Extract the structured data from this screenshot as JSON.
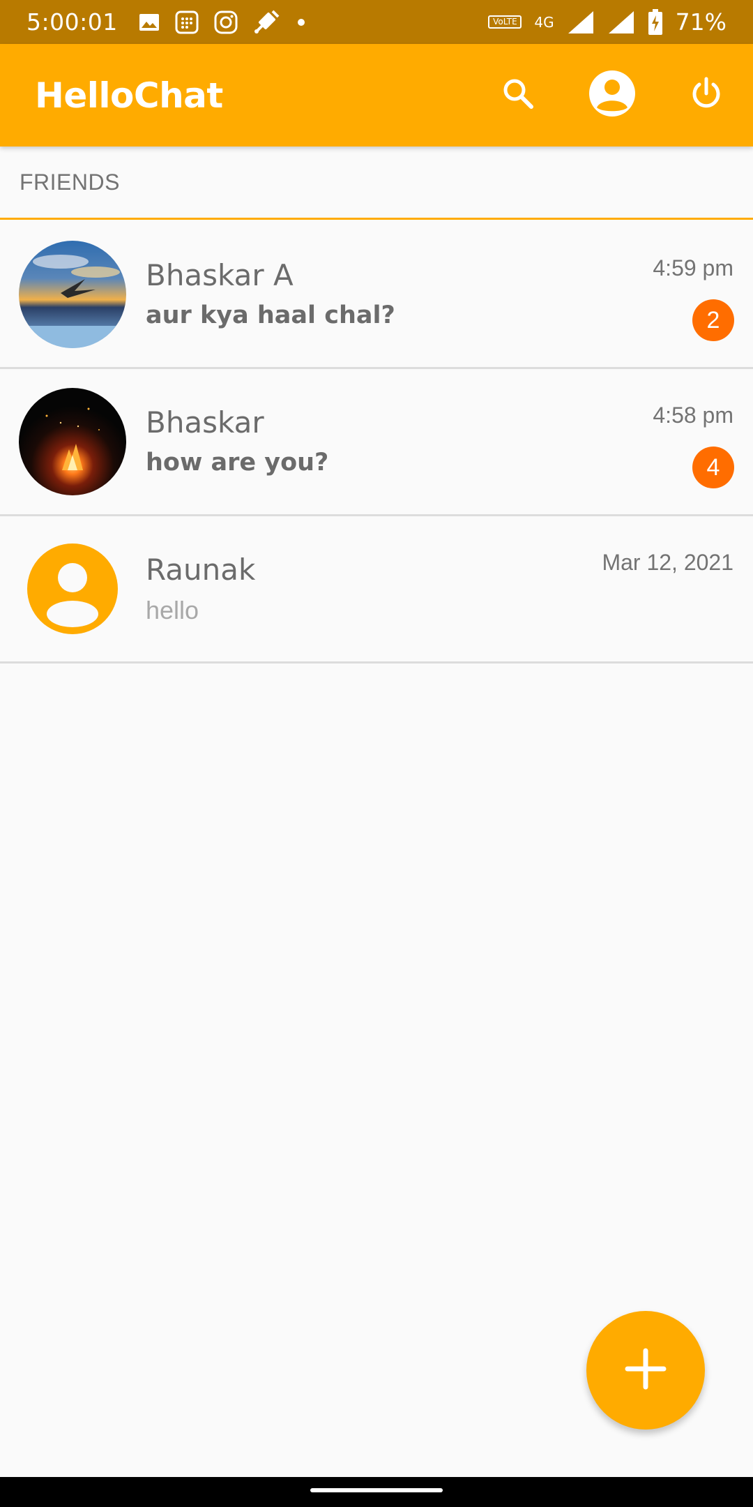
{
  "status_bar": {
    "time": "5:00:01",
    "volte": "VoLTE",
    "network": "4G",
    "battery": "71%",
    "icons": [
      "gallery-icon",
      "calendar-app-icon",
      "instagram-icon",
      "satellite-icon",
      "dot-icon",
      "volte-icon",
      "4g-icon",
      "signal-icon",
      "signal-icon",
      "battery-charging-icon"
    ]
  },
  "app_bar": {
    "title": "HelloChat",
    "background": "#ffab00",
    "actions": [
      "search-icon",
      "account-icon",
      "power-icon"
    ]
  },
  "section": {
    "title": "FRIENDS",
    "accent": "#ffab00"
  },
  "chats": [
    {
      "name": "Bhaskar A",
      "message": "aur kya haal chal?",
      "time": "4:59 pm",
      "unread": "2",
      "avatar": "photo-sunset-bird"
    },
    {
      "name": "Bhaskar",
      "message": "how are you?",
      "time": "4:58 pm",
      "unread": "4",
      "avatar": "photo-campfire"
    },
    {
      "name": "Raunak",
      "message": "hello",
      "time": "Mar 12, 2021",
      "avatar": "default-person-icon"
    }
  ],
  "fab": {
    "icon": "plus-icon",
    "color": "#ffab00"
  },
  "colors": {
    "status_bar": "#b87a00",
    "badge": "#ff6d00",
    "text": "#6b6b6b"
  }
}
